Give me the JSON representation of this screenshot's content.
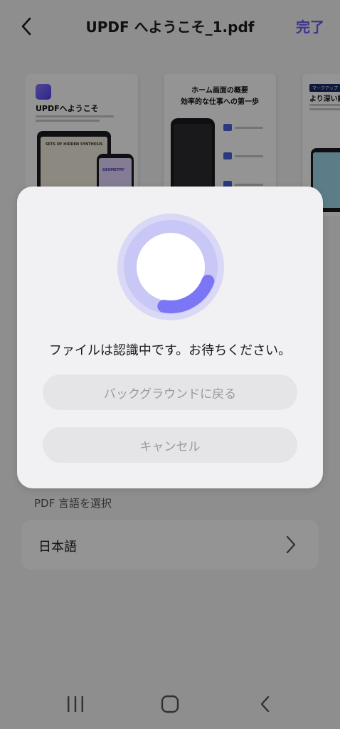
{
  "header": {
    "title": "UPDF へようこそ_1.pdf",
    "done_label": "完了"
  },
  "thumbnails": [
    {
      "heading": "UPDFへようこそ",
      "inner_heading": "SETS OF HIDDEN SYNTHESIS",
      "tag": "GEOMETRY"
    },
    {
      "heading_line1": "ホーム画面の概要",
      "heading_line2": "効率的な仕事への第一歩"
    },
    {
      "badge": "マークアップ",
      "heading": "より深い読書"
    }
  ],
  "language": {
    "section_label": "PDF 言語を選択",
    "selected": "日本語"
  },
  "dialog": {
    "status_text": "ファイルは認識中です。お待ちください。",
    "background_button": "バックグラウンドに戻る",
    "cancel_button": "キャンセル",
    "progress": 0.22,
    "accent_color": "#7b76f5"
  },
  "navbar": {
    "recents_icon": "recents-icon",
    "home_icon": "home-icon",
    "back_icon": "back-icon"
  }
}
